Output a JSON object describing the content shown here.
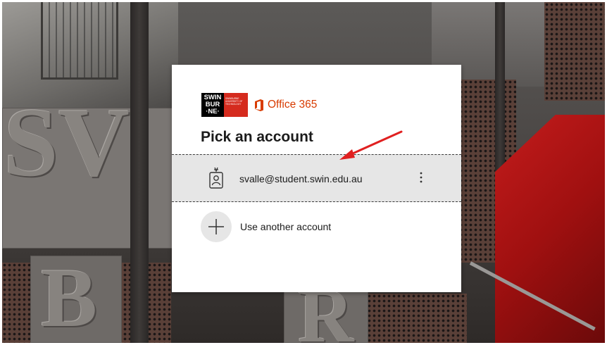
{
  "brand": {
    "swinburne_logo_text": [
      "SWIN",
      "BUR",
      "·NE·"
    ],
    "swinburne_sub_text": "SWINBURNE UNIVERSITY OF TECHNOLOGY",
    "office_label": "Office 365"
  },
  "dialog": {
    "title": "Pick an account",
    "accounts": [
      {
        "email": "svalle@student.swin.edu.au",
        "icon": "badge-user-icon",
        "menu_icon": "more-options-icon"
      }
    ],
    "use_another": {
      "label": "Use another account",
      "icon": "plus-icon"
    }
  },
  "colors": {
    "office_orange": "#d83b01",
    "swin_red": "#d52b1e",
    "row_highlight": "#e6e6e6",
    "annotation_red": "#e02020"
  }
}
